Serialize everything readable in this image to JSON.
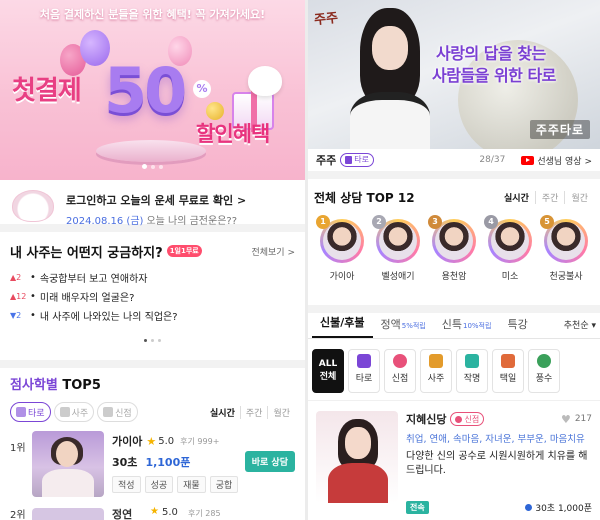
{
  "promo": {
    "subtitle": "처음 결제하신 분들을 위한 혜택! 꼭 가져가세요!",
    "first_payment": "첫결제",
    "percent_value": "50",
    "percent_sign": "%",
    "discount": "할인혜택"
  },
  "login": {
    "title": "로그인하고 오늘의 운세 무료로 확인 >",
    "date": "2024.08.16 (금)",
    "teaser": "오늘 나의 금전운은??"
  },
  "questions": {
    "title": "내 사주는 어떤지 궁금하지?",
    "badge": "1일1무료",
    "more": "전체보기 >",
    "items": [
      {
        "rank_change": "▲2",
        "direction": "up",
        "text": "속궁합부터 보고 연애하자"
      },
      {
        "rank_change": "▲12",
        "direction": "up",
        "text": "미래 배우자의 얼굴은?"
      },
      {
        "rank_change": "▼2",
        "direction": "down",
        "text": "내 사주에 나와있는 나의 직업은?"
      }
    ]
  },
  "top5": {
    "title_accent": "점사학별",
    "title_rest": "TOP5",
    "chips": [
      "타로",
      "사주",
      "신점"
    ],
    "periods": [
      "실시간",
      "주간",
      "월간"
    ],
    "first": {
      "rank": "1위",
      "name": "가이아",
      "star": "★",
      "rating": "5.0",
      "reviews": "후기 999+",
      "seconds": "30초",
      "price": "1,100푼",
      "button": "바로 상담",
      "tags": [
        "적성",
        "성공",
        "재물",
        "궁합"
      ]
    },
    "second": {
      "rank": "2위",
      "name": "정연",
      "rating": "5.0",
      "reviews": "후기 285"
    }
  },
  "video": {
    "logo": "주주",
    "headline_line1": "사랑의 답을 찾는",
    "headline_line2": "사람들을 위한 타로",
    "brand": "주주타로",
    "channel_name": "주주",
    "chip": "타로",
    "counter": "28/37",
    "video_link": "선생님 영상 >"
  },
  "top12": {
    "title": "전체 상담 TOP 12",
    "periods": [
      "실시간",
      "주간",
      "월간"
    ],
    "avatars": [
      {
        "num": "1",
        "name": "가이아"
      },
      {
        "num": "2",
        "name": "벨성애기"
      },
      {
        "num": "3",
        "name": "용천암"
      },
      {
        "num": "4",
        "name": "미소"
      },
      {
        "num": "5",
        "name": "천궁불사"
      }
    ]
  },
  "category_tabs": {
    "tabs": [
      {
        "label": "신불/후불",
        "sub": ""
      },
      {
        "label": "정액",
        "sub": "5%적립"
      },
      {
        "label": "신특",
        "sub": "10%적립"
      },
      {
        "label": "특강",
        "sub": ""
      }
    ],
    "sort": "추천순 ▾"
  },
  "filters": {
    "all_line1": "ALL",
    "all_line2": "전체",
    "items": [
      {
        "label": "타로",
        "color": "#7b46d6"
      },
      {
        "label": "신점",
        "color": "#e8517a"
      },
      {
        "label": "사주",
        "color": "#e39b2b"
      },
      {
        "label": "작명",
        "color": "#2bb3a0"
      },
      {
        "label": "택일",
        "color": "#e06a3a"
      },
      {
        "label": "풍수",
        "color": "#3aa05a"
      }
    ]
  },
  "expert": {
    "name": "지혜신당",
    "chip": "신점",
    "likes": "217",
    "keywords": "취업, 연애, 속마음, 자녀운, 부부운, 마음치유",
    "description": "다양한 신의 공수로 시원시원하게 치유를 해드립니다.",
    "live": "전속",
    "price": "30초 1,000푼"
  },
  "colors": {
    "accent_purple": "#7b46d6",
    "teal_button": "#2bb3a0",
    "price_blue": "#2e66d6",
    "promo_pink": "#e83f83"
  }
}
